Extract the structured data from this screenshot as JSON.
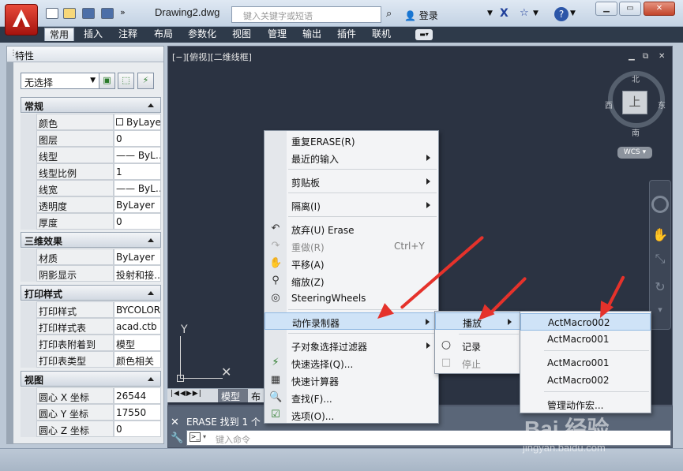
{
  "app": {
    "document_title": "Drawing2.dwg",
    "search_placeholder": "键入关键字或短语",
    "login_label": "登录"
  },
  "ribbon_tabs": [
    "常用",
    "插入",
    "注释",
    "布局",
    "参数化",
    "视图",
    "管理",
    "输出",
    "插件",
    "联机"
  ],
  "properties": {
    "title": "特性",
    "selection": "无选择",
    "sections": [
      {
        "title": "常规",
        "rows": [
          {
            "label": "颜色",
            "value": "ByLayer"
          },
          {
            "label": "图层",
            "value": "0"
          },
          {
            "label": "线型",
            "value": "—— ByL…"
          },
          {
            "label": "线型比例",
            "value": "1"
          },
          {
            "label": "线宽",
            "value": "—— ByL…"
          },
          {
            "label": "透明度",
            "value": "ByLayer"
          },
          {
            "label": "厚度",
            "value": "0"
          }
        ]
      },
      {
        "title": "三维效果",
        "rows": [
          {
            "label": "材质",
            "value": "ByLayer"
          },
          {
            "label": "阴影显示",
            "value": "投射和接…"
          }
        ]
      },
      {
        "title": "打印样式",
        "rows": [
          {
            "label": "打印样式",
            "value": "BYCOLOR"
          },
          {
            "label": "打印样式表",
            "value": "acad.ctb"
          },
          {
            "label": "打印表附着到",
            "value": "模型"
          },
          {
            "label": "打印表类型",
            "value": "颜色相关"
          }
        ]
      },
      {
        "title": "视图",
        "rows": [
          {
            "label": "圆心 X 坐标",
            "value": "26544"
          },
          {
            "label": "圆心 Y 坐标",
            "value": "17550"
          },
          {
            "label": "圆心 Z 坐标",
            "value": "0"
          }
        ]
      }
    ]
  },
  "viewport": {
    "label": "[−][俯视][二维线框]",
    "compass": {
      "north": "北",
      "south": "南",
      "east": "东",
      "west": "西",
      "cube": "上"
    },
    "wcs_label": "WCS",
    "ucs_y": "Y"
  },
  "layout_tabs": {
    "model": "模型",
    "layout": "布局"
  },
  "command": {
    "history": "ERASE 找到 1 个",
    "placeholder": "键入命令"
  },
  "context_menu": {
    "items": [
      {
        "label": "重复ERASE(R)"
      },
      {
        "label": "最近的输入",
        "submenu": true
      },
      {
        "label": "剪贴板",
        "submenu": true
      },
      {
        "label": "隔离(I)",
        "submenu": true
      },
      {
        "label": "放弃(U) Erase",
        "icon": "undo-icon"
      },
      {
        "label": "重做(R)",
        "shortcut": "Ctrl+Y",
        "disabled": true,
        "icon": "redo-icon"
      },
      {
        "label": "平移(A)",
        "icon": "pan-icon"
      },
      {
        "label": "缩放(Z)",
        "icon": "zoom-icon"
      },
      {
        "label": "SteeringWheels",
        "icon": "steering-wheel-icon"
      },
      {
        "label": "动作录制器",
        "submenu": true,
        "highlighted": true
      },
      {
        "label": "子对象选择过滤器",
        "submenu": true
      },
      {
        "label": "快速选择(Q)...",
        "icon": "quick-select-icon"
      },
      {
        "label": "快速计算器",
        "icon": "calculator-icon"
      },
      {
        "label": "查找(F)...",
        "icon": "find-icon"
      },
      {
        "label": "选项(O)...",
        "icon": "options-icon"
      }
    ]
  },
  "recorder_menu": {
    "items": [
      {
        "label": "播放",
        "submenu": true,
        "highlighted": true
      },
      {
        "label": "记录"
      },
      {
        "label": "停止",
        "disabled": true
      }
    ]
  },
  "play_menu": {
    "items": [
      {
        "label": "ActMacro002",
        "highlighted": true
      },
      {
        "label": "ActMacro001"
      },
      {
        "label": "ActMacro001"
      },
      {
        "label": "ActMacro002"
      },
      {
        "label": "管理动作宏..."
      }
    ]
  },
  "watermark": {
    "logo": "Bai 经验",
    "url": "jingyan.baidu.com"
  },
  "colors": {
    "canvas": "#2b3342",
    "menu_highlight": "#cfe3f7",
    "arrow": "#e5322b",
    "app_button": "#c0221a"
  }
}
